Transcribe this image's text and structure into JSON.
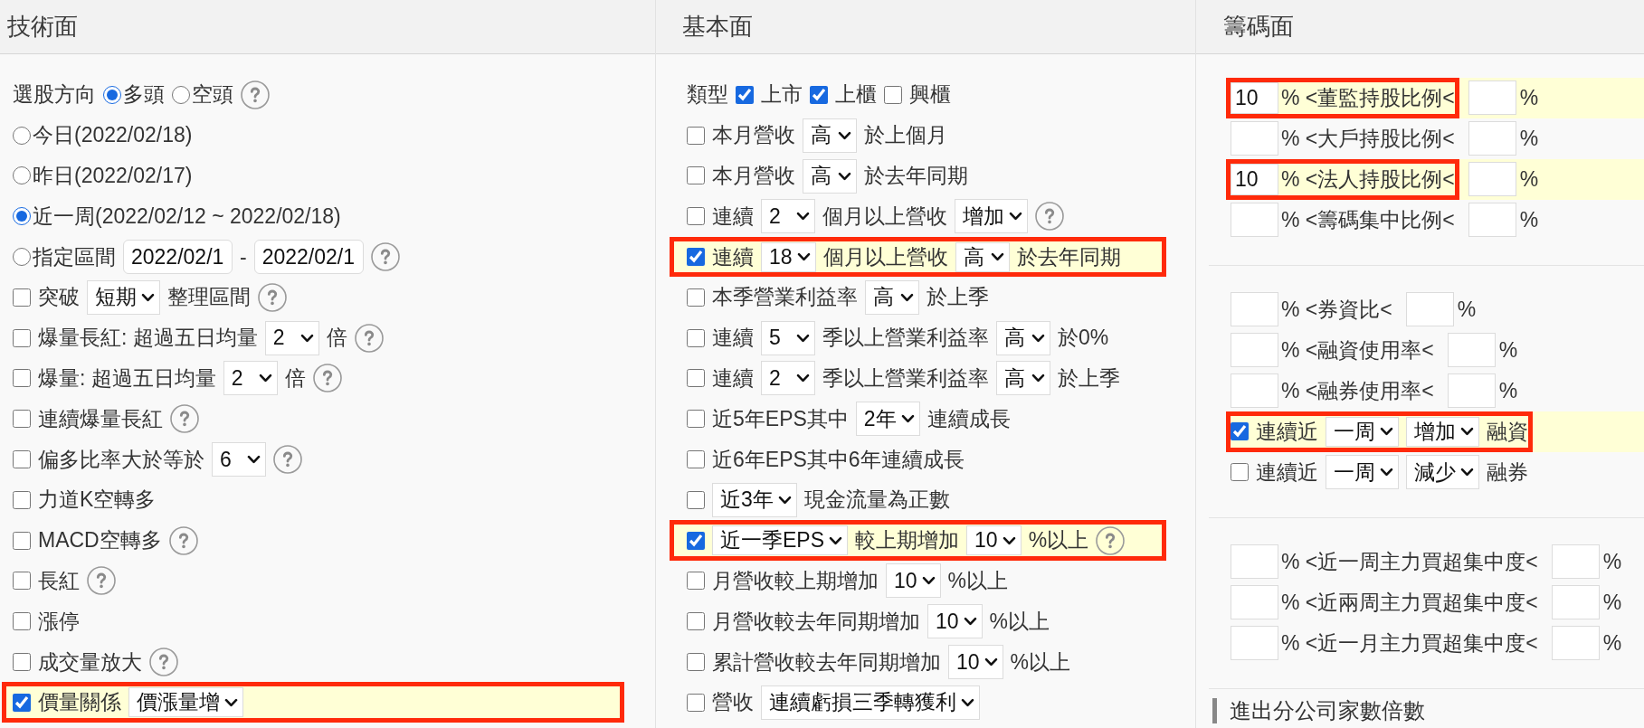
{
  "panels": [
    {
      "title": "技術面",
      "groups": [
        {
          "rows": [
            {
              "kind": "parts",
              "highlighted": false,
              "parts": [
                {
                  "kind": "text",
                  "text": "選股方向"
                },
                {
                  "kind": "radio",
                  "label": "多頭",
                  "selected": true
                },
                {
                  "kind": "radio",
                  "label": "空頭",
                  "selected": false
                },
                {
                  "kind": "help"
                }
              ]
            },
            {
              "kind": "parts",
              "highlighted": false,
              "parts": [
                {
                  "kind": "radio",
                  "label": "今日(2022/02/18)",
                  "selected": false
                }
              ]
            },
            {
              "kind": "parts",
              "highlighted": false,
              "parts": [
                {
                  "kind": "radio",
                  "label": "昨日(2022/02/17)",
                  "selected": false
                }
              ]
            },
            {
              "kind": "parts",
              "highlighted": false,
              "parts": [
                {
                  "kind": "radio",
                  "label": "近一周(2022/02/12 ~ 2022/02/18)",
                  "selected": true
                }
              ]
            },
            {
              "kind": "parts",
              "highlighted": false,
              "parts": [
                {
                  "kind": "radio",
                  "label": "指定區間",
                  "selected": false
                },
                {
                  "kind": "date",
                  "value": "2022/02/1"
                },
                {
                  "kind": "text",
                  "text": "-"
                },
                {
                  "kind": "date",
                  "value": "2022/02/1"
                },
                {
                  "kind": "help"
                }
              ]
            },
            {
              "kind": "parts",
              "highlighted": false,
              "parts": [
                {
                  "kind": "checkbox",
                  "checked": false
                },
                {
                  "kind": "text",
                  "text": "突破"
                },
                {
                  "kind": "select",
                  "value": "短期"
                },
                {
                  "kind": "text",
                  "text": "整理區間"
                },
                {
                  "kind": "help"
                }
              ]
            },
            {
              "kind": "parts",
              "highlighted": false,
              "parts": [
                {
                  "kind": "checkbox",
                  "checked": false
                },
                {
                  "kind": "text",
                  "text": "爆量長紅: 超過五日均量"
                },
                {
                  "kind": "select",
                  "value": "2"
                },
                {
                  "kind": "text",
                  "text": "倍"
                },
                {
                  "kind": "help"
                }
              ]
            },
            {
              "kind": "parts",
              "highlighted": false,
              "parts": [
                {
                  "kind": "checkbox",
                  "checked": false
                },
                {
                  "kind": "text",
                  "text": "爆量: 超過五日均量"
                },
                {
                  "kind": "select",
                  "value": "2"
                },
                {
                  "kind": "text",
                  "text": "倍"
                },
                {
                  "kind": "help"
                }
              ]
            },
            {
              "kind": "parts",
              "highlighted": false,
              "parts": [
                {
                  "kind": "checkbox",
                  "checked": false
                },
                {
                  "kind": "text",
                  "text": "連續爆量長紅"
                },
                {
                  "kind": "help"
                }
              ]
            },
            {
              "kind": "parts",
              "highlighted": false,
              "parts": [
                {
                  "kind": "checkbox",
                  "checked": false
                },
                {
                  "kind": "text",
                  "text": "偏多比率大於等於"
                },
                {
                  "kind": "select",
                  "value": "6"
                },
                {
                  "kind": "help"
                }
              ]
            },
            {
              "kind": "parts",
              "highlighted": false,
              "parts": [
                {
                  "kind": "checkbox",
                  "checked": false
                },
                {
                  "kind": "text",
                  "text": "力道K空轉多"
                }
              ]
            },
            {
              "kind": "parts",
              "highlighted": false,
              "parts": [
                {
                  "kind": "checkbox",
                  "checked": false
                },
                {
                  "kind": "text",
                  "text": "MACD空轉多"
                },
                {
                  "kind": "help"
                }
              ]
            },
            {
              "kind": "parts",
              "highlighted": false,
              "parts": [
                {
                  "kind": "checkbox",
                  "checked": false
                },
                {
                  "kind": "text",
                  "text": "長紅"
                },
                {
                  "kind": "help"
                }
              ]
            },
            {
              "kind": "parts",
              "highlighted": false,
              "parts": [
                {
                  "kind": "checkbox",
                  "checked": false
                },
                {
                  "kind": "text",
                  "text": "漲停"
                }
              ]
            },
            {
              "kind": "parts",
              "highlighted": false,
              "parts": [
                {
                  "kind": "checkbox",
                  "checked": false
                },
                {
                  "kind": "text",
                  "text": "成交量放大"
                },
                {
                  "kind": "help"
                }
              ]
            },
            {
              "kind": "parts",
              "highlighted": true,
              "parts": [
                {
                  "kind": "checkbox",
                  "checked": true
                },
                {
                  "kind": "text",
                  "text": "價量關係"
                },
                {
                  "kind": "select",
                  "value": "價漲量增"
                }
              ]
            }
          ]
        }
      ]
    },
    {
      "title": "基本面",
      "groups": [
        {
          "rows": [
            {
              "kind": "parts",
              "highlighted": false,
              "parts": [
                {
                  "kind": "text",
                  "text": "類型"
                },
                {
                  "kind": "checkbox",
                  "checked": true
                },
                {
                  "kind": "text",
                  "text": "上市"
                },
                {
                  "kind": "checkbox",
                  "checked": true
                },
                {
                  "kind": "text",
                  "text": "上櫃"
                },
                {
                  "kind": "checkbox",
                  "checked": false
                },
                {
                  "kind": "text",
                  "text": "興櫃"
                }
              ]
            },
            {
              "kind": "parts",
              "highlighted": false,
              "parts": [
                {
                  "kind": "checkbox",
                  "checked": false
                },
                {
                  "kind": "text",
                  "text": "本月營收"
                },
                {
                  "kind": "select",
                  "value": "高"
                },
                {
                  "kind": "text",
                  "text": "於上個月"
                }
              ]
            },
            {
              "kind": "parts",
              "highlighted": false,
              "parts": [
                {
                  "kind": "checkbox",
                  "checked": false
                },
                {
                  "kind": "text",
                  "text": "本月營收"
                },
                {
                  "kind": "select",
                  "value": "高"
                },
                {
                  "kind": "text",
                  "text": "於去年同期"
                }
              ]
            },
            {
              "kind": "parts",
              "highlighted": false,
              "parts": [
                {
                  "kind": "checkbox",
                  "checked": false
                },
                {
                  "kind": "text",
                  "text": "連續"
                },
                {
                  "kind": "select",
                  "value": "2"
                },
                {
                  "kind": "text",
                  "text": "個月以上營收"
                },
                {
                  "kind": "select",
                  "value": "增加"
                },
                {
                  "kind": "help"
                }
              ]
            },
            {
              "kind": "parts",
              "highlighted": true,
              "parts": [
                {
                  "kind": "checkbox",
                  "checked": true
                },
                {
                  "kind": "text",
                  "text": "連續"
                },
                {
                  "kind": "select",
                  "value": "18"
                },
                {
                  "kind": "text",
                  "text": "個月以上營收"
                },
                {
                  "kind": "select",
                  "value": "高"
                },
                {
                  "kind": "text",
                  "text": "於去年同期"
                }
              ]
            },
            {
              "kind": "parts",
              "highlighted": false,
              "parts": [
                {
                  "kind": "checkbox",
                  "checked": false
                },
                {
                  "kind": "text",
                  "text": "本季營業利益率"
                },
                {
                  "kind": "select",
                  "value": "高"
                },
                {
                  "kind": "text",
                  "text": "於上季"
                }
              ]
            },
            {
              "kind": "parts",
              "highlighted": false,
              "parts": [
                {
                  "kind": "checkbox",
                  "checked": false
                },
                {
                  "kind": "text",
                  "text": "連續"
                },
                {
                  "kind": "select",
                  "value": "5"
                },
                {
                  "kind": "text",
                  "text": "季以上營業利益率"
                },
                {
                  "kind": "select",
                  "value": "高"
                },
                {
                  "kind": "text",
                  "text": "於0%"
                }
              ]
            },
            {
              "kind": "parts",
              "highlighted": false,
              "parts": [
                {
                  "kind": "checkbox",
                  "checked": false
                },
                {
                  "kind": "text",
                  "text": "連續"
                },
                {
                  "kind": "select",
                  "value": "2"
                },
                {
                  "kind": "text",
                  "text": "季以上營業利益率"
                },
                {
                  "kind": "select",
                  "value": "高"
                },
                {
                  "kind": "text",
                  "text": "於上季"
                }
              ]
            },
            {
              "kind": "parts",
              "highlighted": false,
              "parts": [
                {
                  "kind": "checkbox",
                  "checked": false
                },
                {
                  "kind": "text",
                  "text": "近5年EPS其中"
                },
                {
                  "kind": "select",
                  "value": "2年"
                },
                {
                  "kind": "text",
                  "text": "連續成長"
                }
              ]
            },
            {
              "kind": "parts",
              "highlighted": false,
              "parts": [
                {
                  "kind": "checkbox",
                  "checked": false
                },
                {
                  "kind": "text",
                  "text": "近6年EPS其中6年連續成長"
                }
              ]
            },
            {
              "kind": "parts",
              "highlighted": false,
              "parts": [
                {
                  "kind": "checkbox",
                  "checked": false
                },
                {
                  "kind": "select",
                  "value": "近3年"
                },
                {
                  "kind": "text",
                  "text": "現金流量為正數"
                }
              ]
            },
            {
              "kind": "parts",
              "highlighted": true,
              "parts": [
                {
                  "kind": "checkbox",
                  "checked": true
                },
                {
                  "kind": "select",
                  "value": "近一季EPS"
                },
                {
                  "kind": "text",
                  "text": "較上期增加"
                },
                {
                  "kind": "select",
                  "value": "10"
                },
                {
                  "kind": "text",
                  "text": "%以上"
                },
                {
                  "kind": "help"
                }
              ]
            },
            {
              "kind": "parts",
              "highlighted": false,
              "parts": [
                {
                  "kind": "checkbox",
                  "checked": false
                },
                {
                  "kind": "text",
                  "text": "月營收較上期增加"
                },
                {
                  "kind": "select",
                  "value": "10"
                },
                {
                  "kind": "text",
                  "text": "%以上"
                }
              ]
            },
            {
              "kind": "parts",
              "highlighted": false,
              "parts": [
                {
                  "kind": "checkbox",
                  "checked": false
                },
                {
                  "kind": "text",
                  "text": "月營收較去年同期增加"
                },
                {
                  "kind": "select",
                  "value": "10"
                },
                {
                  "kind": "text",
                  "text": "%以上"
                }
              ]
            },
            {
              "kind": "parts",
              "highlighted": false,
              "parts": [
                {
                  "kind": "checkbox",
                  "checked": false
                },
                {
                  "kind": "text",
                  "text": "累計營收較去年同期增加"
                },
                {
                  "kind": "select",
                  "value": "10"
                },
                {
                  "kind": "text",
                  "text": "%以上"
                }
              ]
            },
            {
              "kind": "parts",
              "highlighted": false,
              "parts": [
                {
                  "kind": "checkbox",
                  "checked": false
                },
                {
                  "kind": "text",
                  "text": "營收"
                },
                {
                  "kind": "select",
                  "value": "連續虧損三季轉獲利"
                }
              ]
            }
          ]
        }
      ]
    },
    {
      "title": "籌碼面",
      "groups": [
        {
          "rows": [
            {
              "kind": "range",
              "highlighted": true,
              "min": "10",
              "label": "% <董監持股比例<",
              "unit": "%"
            },
            {
              "kind": "range",
              "highlighted": false,
              "label": "% <大戶持股比例<",
              "unit": "%"
            },
            {
              "kind": "range",
              "highlighted": true,
              "min": "10",
              "label": "% <法人持股比例<",
              "unit": "%"
            },
            {
              "kind": "range",
              "highlighted": false,
              "label": "% <籌碼集中比例<",
              "unit": "%"
            }
          ]
        },
        {
          "rows": [
            {
              "kind": "range",
              "highlighted": false,
              "label": "% <券資比<",
              "unit": "%"
            },
            {
              "kind": "range",
              "highlighted": false,
              "label": "% <融資使用率<",
              "unit": "%"
            },
            {
              "kind": "range",
              "highlighted": false,
              "label": "% <融券使用率<",
              "unit": "%"
            },
            {
              "kind": "parts",
              "highlighted": true,
              "parts": [
                {
                  "kind": "checkbox",
                  "checked": true
                },
                {
                  "kind": "text",
                  "text": "連續近"
                },
                {
                  "kind": "select",
                  "value": "一周"
                },
                {
                  "kind": "select",
                  "value": "增加"
                },
                {
                  "kind": "text",
                  "text": "融資"
                }
              ]
            },
            {
              "kind": "parts",
              "highlighted": false,
              "parts": [
                {
                  "kind": "checkbox",
                  "checked": false
                },
                {
                  "kind": "text",
                  "text": "連續近"
                },
                {
                  "kind": "select",
                  "value": "一周"
                },
                {
                  "kind": "select",
                  "value": "減少"
                },
                {
                  "kind": "text",
                  "text": "融券"
                }
              ]
            }
          ]
        },
        {
          "rows": [
            {
              "kind": "range",
              "highlighted": false,
              "label": "% <近一周主力買超集中度<",
              "unit": "%"
            },
            {
              "kind": "range",
              "highlighted": false,
              "label": "% <近兩周主力買超集中度<",
              "unit": "%"
            },
            {
              "kind": "range",
              "highlighted": false,
              "label": "% <近一月主力買超集中度<",
              "unit": "%"
            }
          ]
        }
      ],
      "section_heading": "進出分公司家數倍數"
    }
  ]
}
